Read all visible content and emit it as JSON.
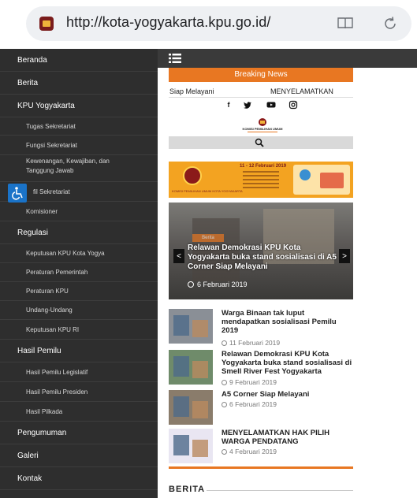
{
  "browser": {
    "url": "http://kota-yogyakarta.kpu.go.id/",
    "favicon": "kpu-favicon-icon",
    "reader_icon": "book-icon",
    "reload_icon": "reload-icon"
  },
  "sidebar": {
    "items": [
      {
        "label": "Beranda",
        "type": "main"
      },
      {
        "label": "Berita",
        "type": "main"
      },
      {
        "label": "KPU Yogyakarta",
        "type": "main"
      },
      {
        "label": "Tugas Sekretariat",
        "type": "sub"
      },
      {
        "label": "Fungsi Sekretariat",
        "type": "sub"
      },
      {
        "label": "Kewenangan, Kewajiban, dan Tanggung Jawab",
        "type": "sub"
      },
      {
        "label": "fil Sekretariat",
        "type": "sub"
      },
      {
        "label": "Komisioner",
        "type": "sub"
      },
      {
        "label": "Regulasi",
        "type": "main"
      },
      {
        "label": "Keputusan KPU Kota Yogya",
        "type": "sub"
      },
      {
        "label": "Peraturan Pemerintah",
        "type": "sub"
      },
      {
        "label": "Peraturan KPU",
        "type": "sub"
      },
      {
        "label": "Undang-Undang",
        "type": "sub"
      },
      {
        "label": "Keputusan KPU RI",
        "type": "sub"
      },
      {
        "label": "Hasil Pemilu",
        "type": "main"
      },
      {
        "label": "Hasil Pemilu Legislatif",
        "type": "sub"
      },
      {
        "label": "Hasil Pemilu Presiden",
        "type": "sub"
      },
      {
        "label": "Hasil Pilkada",
        "type": "sub"
      },
      {
        "label": "Pengumuman",
        "type": "main"
      },
      {
        "label": "Galeri",
        "type": "main"
      },
      {
        "label": "Kontak",
        "type": "main"
      }
    ]
  },
  "main": {
    "breaking_label": "Breaking News",
    "ticker_label": "Siap Melayani",
    "ticker_text": "MENYELAMATKAN",
    "social_icons": [
      "facebook-icon",
      "twitter-icon",
      "youtube-icon",
      "instagram-icon"
    ],
    "logo_text": "KOMISI PEMILIHAN UMUM",
    "banner": {
      "title": "11 - 12 Februari 2019",
      "left_text": "KOMISI PEMILIHAN UMUM KOTA YOGYAKARTA"
    },
    "slider": {
      "tag": "Berita",
      "title": "Relawan Demokrasi KPU Kota Yogyakarta buka stand sosialisasi di A5 Corner Siap Melayani",
      "date": "6 Februari 2019",
      "prev": "<",
      "next": ">"
    },
    "news": [
      {
        "title": "Warga Binaan tak luput mendapatkan sosialisasi Pemilu 2019",
        "date": "11 Februari 2019"
      },
      {
        "title": "Relawan Demokrasi KPU Kota Yogyakarta buka stand sosialisasi di Smell River Fest Yogyakarta",
        "date": "9 Februari 2019"
      },
      {
        "title": "A5 Corner Siap Melayani",
        "date": "6 Februari 2019"
      },
      {
        "title": "MENYELAMATKAN HAK PILIH WARGA PENDATANG",
        "date": "4 Februari 2019"
      }
    ],
    "section_heading": "BERITA"
  },
  "colors": {
    "accent": "#e87722",
    "sidebar_bg": "#2e2e2e",
    "topbar_bg": "#3a3a3a"
  }
}
